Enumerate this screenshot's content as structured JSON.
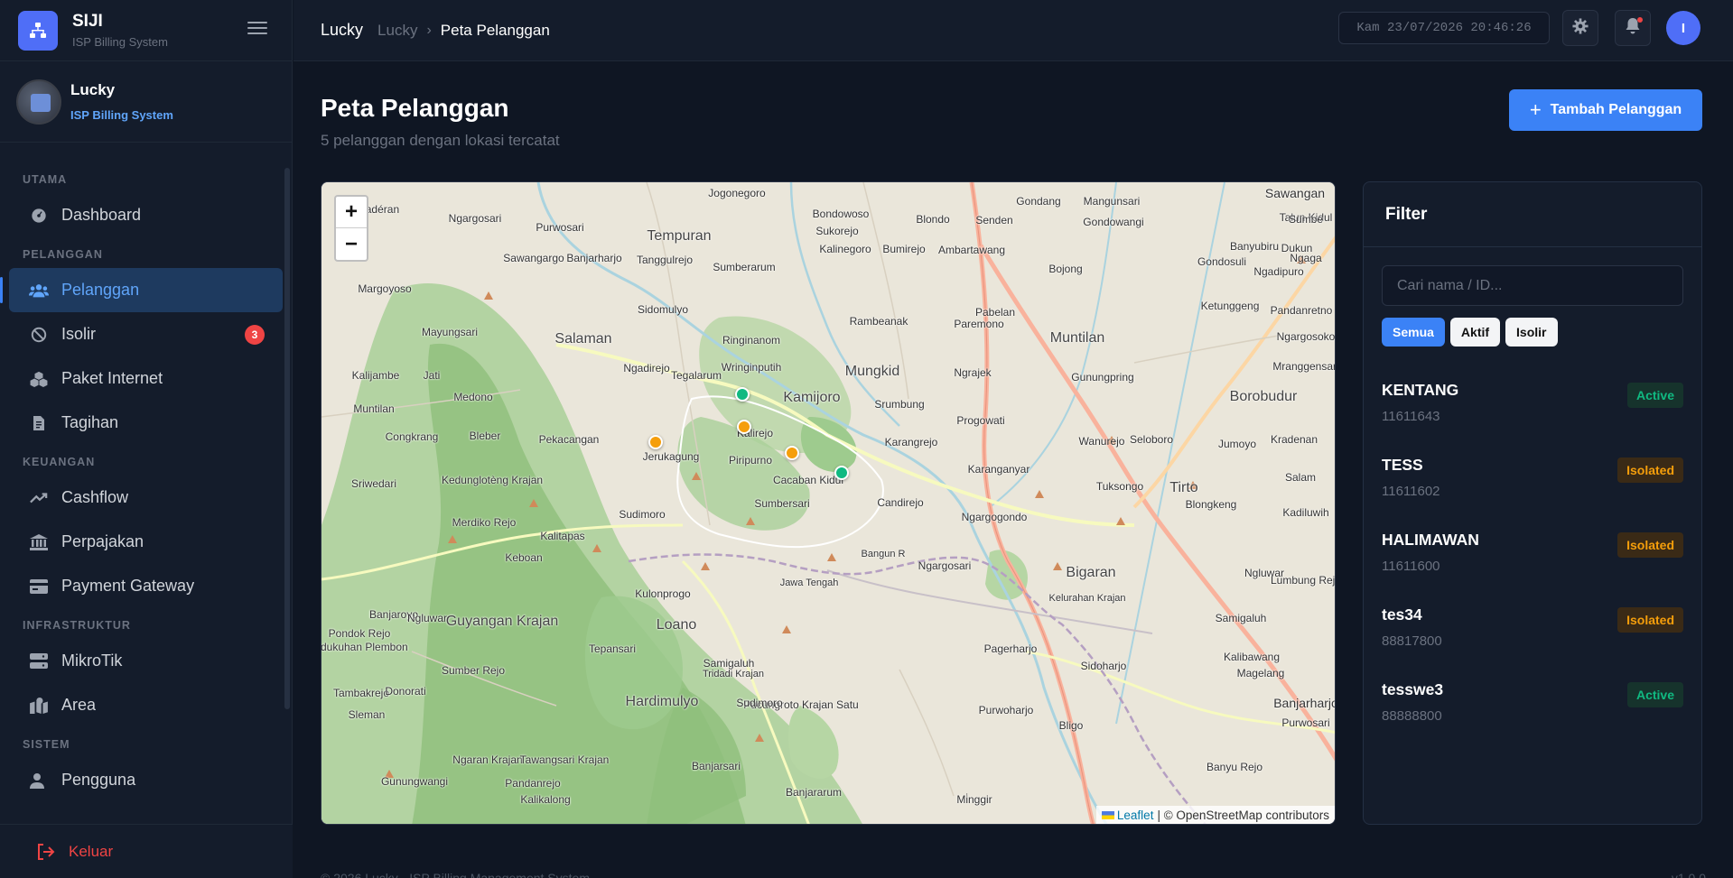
{
  "brand": {
    "name": "SIJI",
    "subtitle": "ISP Billing System"
  },
  "user": {
    "name": "Lucky",
    "role": "ISP Billing System"
  },
  "nav": {
    "sections": {
      "utama": "UTAMA",
      "pelanggan": "PELANGGAN",
      "keuangan": "KEUANGAN",
      "infrastruktur": "INFRASTRUKTUR",
      "sistem": "SISTEM"
    },
    "items": {
      "dashboard": "Dashboard",
      "pelanggan": "Pelanggan",
      "isolir": "Isolir",
      "isolir_badge": "3",
      "paket": "Paket Internet",
      "tagihan": "Tagihan",
      "cashflow": "Cashflow",
      "perpajakan": "Perpajakan",
      "payment": "Payment Gateway",
      "mikrotik": "MikroTik",
      "area": "Area",
      "pengguna": "Pengguna"
    },
    "logout": "Keluar"
  },
  "topbar": {
    "root": "Lucky",
    "crumb": "Lucky",
    "current": "Peta Pelanggan",
    "clock": "Kam 23/07/2026 20:46:26",
    "avatar_initial": "I"
  },
  "page": {
    "title": "Peta Pelanggan",
    "subtitle": "5 pelanggan dengan lokasi tercatat",
    "add_button": "Tambah Pelanggan"
  },
  "map": {
    "zoom_in": "+",
    "zoom_out": "−",
    "attribution_link": "Leaflet",
    "attribution_text": "| © OpenStreetMap contributors",
    "places": [
      "Jogonegoro",
      "Gondang",
      "Mangunsari",
      "Sawangan",
      "Wadéran",
      "Ngargosari",
      "Purwosari",
      "Bondowoso",
      "Blondo",
      "Senden",
      "Gondowangi",
      "Talun Kidul",
      "Sumbe",
      "Tempuran",
      "Sukorejo",
      "Sawangargo",
      "Banjarharjo",
      "Tanggulrejo",
      "Kalinegoro",
      "Bumirejo",
      "Ambartawang",
      "Bojong",
      "Banyubiru",
      "Dukun",
      "Sumberarum",
      "Gondosuli",
      "Ngadipuro",
      "Ngaga",
      "Margoyoso",
      "Ketunggeng",
      "Sidomulyo",
      "Pabelan",
      "Pandanretno",
      "Mayungsari",
      "Salaman",
      "Ringinanom",
      "Rambeanak",
      "Paremono",
      "Muntilan",
      "Ngargosoko",
      "Ngadirejo",
      "Wringinputih",
      "Mungkid",
      "Kalijambe",
      "Jati",
      "Tegalarum",
      "Ngrajek",
      "Gunungpring",
      "Mranggensari",
      "Medono",
      "Muntilan",
      "Kamijoro",
      "Borobudur",
      "Srumbung",
      "Progowati",
      "Congkrang",
      "Bleber",
      "Pekacangan",
      "Kalirejo",
      "Karangrejo",
      "Wanurejo",
      "Seloboro",
      "Jumoyo",
      "Kradenan",
      "Jerukagung",
      "Piripurno",
      "Karanganyar",
      "Sriwedari",
      "Kedunglotèng Krajan",
      "Cacaban Kidul",
      "Tuksongo",
      "Tirto",
      "Salam",
      "Sudimoro",
      "Sumbersari",
      "Candirejo",
      "Ngargogondo",
      "Blongkeng",
      "Kadiluwih",
      "Merdiko Rejo",
      "Kalitapas",
      "Keboan",
      "Ngargosari",
      "Bigaran",
      "Ngluwar",
      "Lumbung Rejo",
      "Bangun R",
      "Jawa Tengah",
      "Kulonprogo",
      "Kelurahan Krajan",
      "Banjaroyo",
      "Ngluwar",
      "Guyangan Krajan",
      "Loano",
      "Samigaluh",
      "Pondok Rejo",
      "Tepansari",
      "Pagerharjo",
      "Kalibawang",
      "Sumber Rejo",
      "Tridadi Krajan",
      "Samigaluh",
      "Sidoharjo",
      "Magelang",
      "Tambakrejo",
      "Donorati",
      "Hardimulyo",
      "Pucungroto Krajan Satu",
      "Banjarharjo",
      "Sleman",
      "Sudimoro",
      "Purwoharjo",
      "Bligo",
      "Ngaran Krajan",
      "Tawangsari Krajan",
      "Banjarsari",
      "Banyu Rejo",
      "Gunungwangi",
      "Pandanrejo",
      "Banjararum",
      "Padukuhan Plembon",
      "Purwosari",
      "Mi̇nggir",
      "Kalikalong"
    ]
  },
  "filter": {
    "title": "Filter",
    "search_placeholder": "Cari nama / ID...",
    "chips": [
      "Semua",
      "Aktif",
      "Isolir"
    ],
    "customers": [
      {
        "name": "KENTANG",
        "id": "11611643",
        "status": "Active"
      },
      {
        "name": "TESS",
        "id": "11611602",
        "status": "Isolated"
      },
      {
        "name": "HALIMAWAN",
        "id": "11611600",
        "status": "Isolated"
      },
      {
        "name": "tes34",
        "id": "88817800",
        "status": "Isolated"
      },
      {
        "name": "tesswe3",
        "id": "88888800",
        "status": "Active"
      }
    ]
  },
  "footer": {
    "text": "© 2026 Lucky · ISP Billing Management System",
    "version": "v1.0.0"
  },
  "colors": {
    "accent": "#3b82f6",
    "active": "#10b981",
    "isolated": "#f59e0b",
    "danger": "#ef4444"
  }
}
